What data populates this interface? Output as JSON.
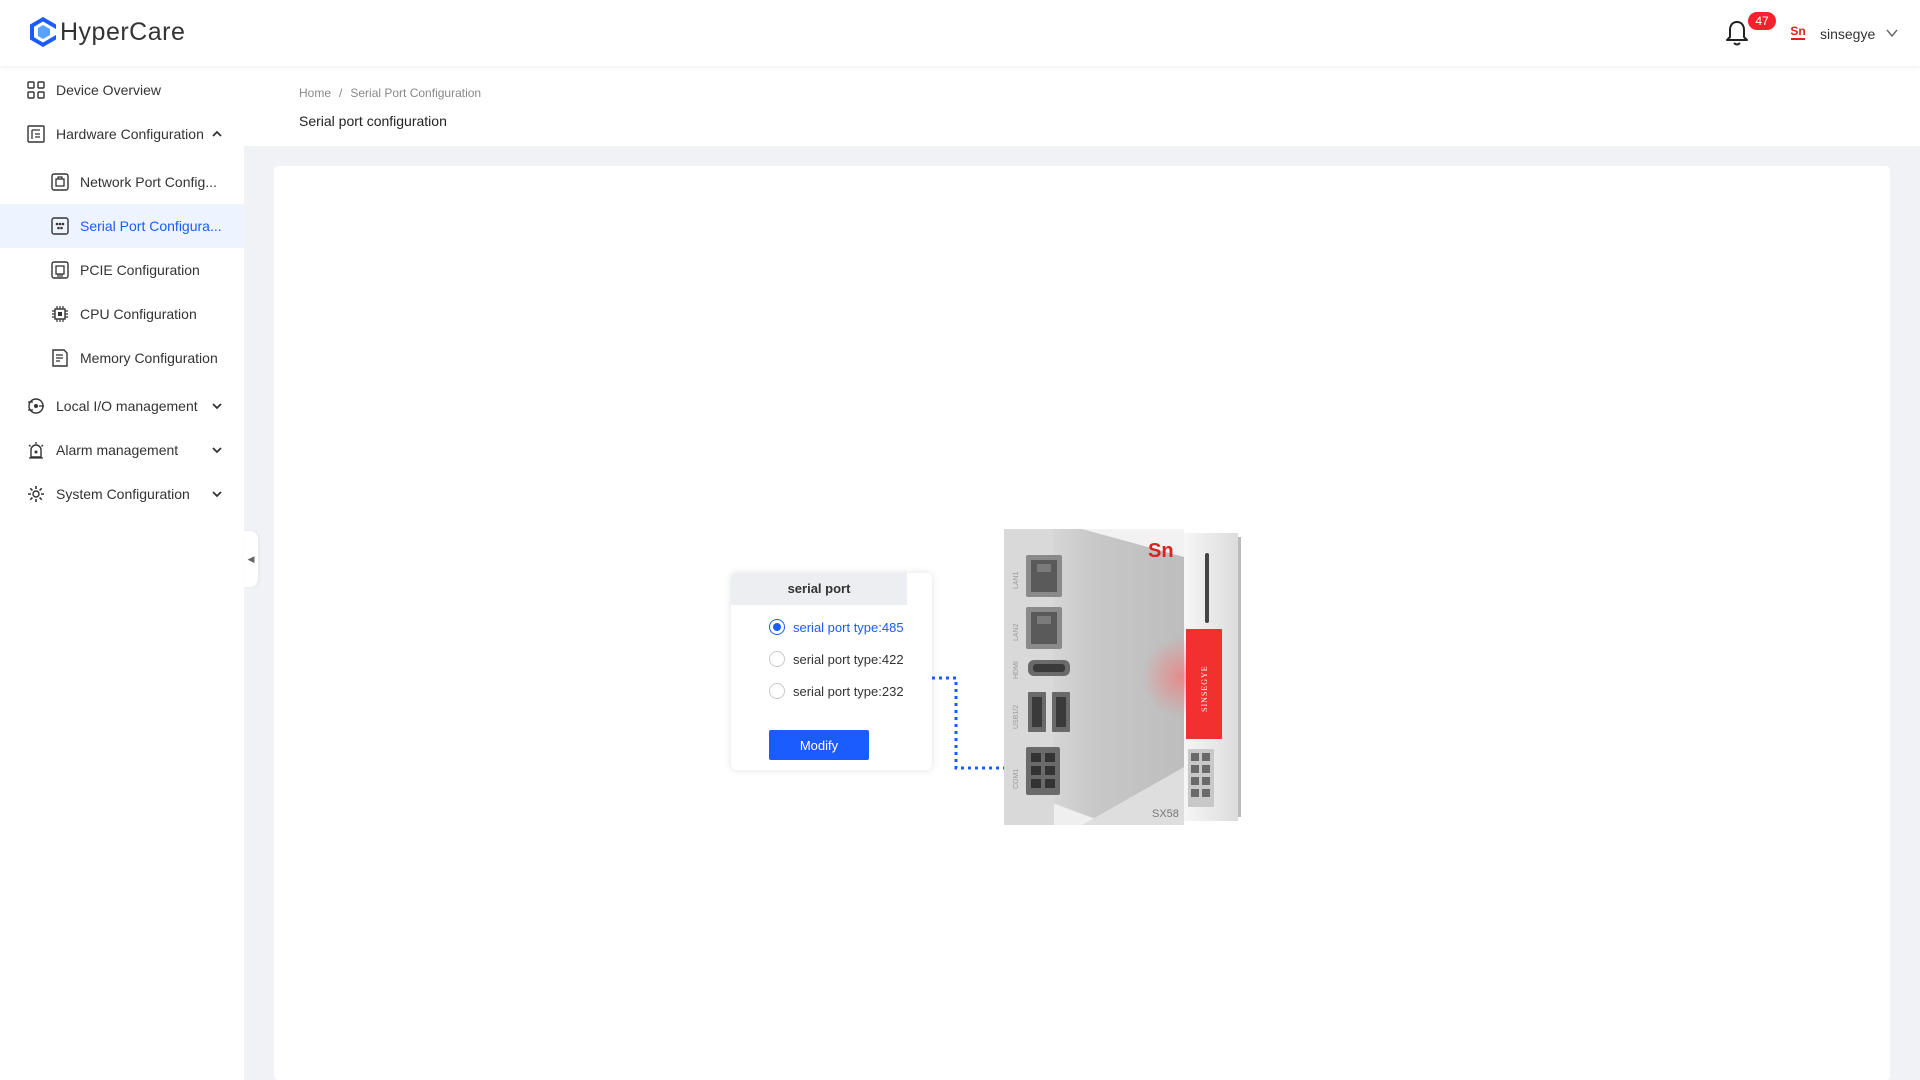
{
  "app": {
    "name": "HyperCare"
  },
  "header": {
    "notification_count": "47",
    "user_name": "sinsegye",
    "user_logo_text": "Sn"
  },
  "sidebar": {
    "items": [
      {
        "label": "Device Overview"
      },
      {
        "label": "Hardware Configuration"
      },
      {
        "label": "Network Port Config..."
      },
      {
        "label": "Serial Port Configura..."
      },
      {
        "label": "PCIE Configuration"
      },
      {
        "label": "CPU Configuration"
      },
      {
        "label": "Memory Configuration"
      },
      {
        "label": "Local I/O management"
      },
      {
        "label": "Alarm management"
      },
      {
        "label": "System Configuration"
      }
    ],
    "collapse_glyph": "◀"
  },
  "breadcrumb": {
    "home": "Home",
    "separator": "/",
    "current": "Serial Port Configuration"
  },
  "page": {
    "title": "Serial port configuration"
  },
  "serial_panel": {
    "title": "serial port",
    "options": [
      {
        "label": "serial port type:485",
        "checked": true
      },
      {
        "label": "serial port type:422",
        "checked": false
      },
      {
        "label": "serial port type:232",
        "checked": false
      }
    ],
    "modify_label": "Modify"
  },
  "device": {
    "brand_label": "SINSEGYE",
    "model": "SX58",
    "port_labels": [
      "LAN1",
      "LAN2",
      "HDMI",
      "USB1/2",
      "COM1"
    ],
    "logo_text": "Sn"
  },
  "colors": {
    "accent": "#1a5cff",
    "badge": "#f5222d",
    "device_red": "#f23030"
  }
}
